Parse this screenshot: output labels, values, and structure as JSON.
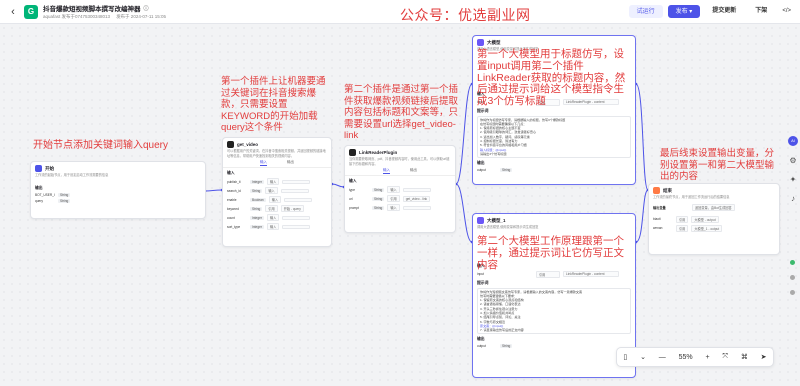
{
  "header": {
    "back": "‹",
    "app_icon_letter": "G",
    "title": "抖音爆款短视频脚本撰写改编神器",
    "meta_user": "aquafast  发布于07475300348013",
    "meta_time": "发布于 2024-07-11 15:05",
    "watermark": "公众号：优选副业网",
    "test_run": "试运行",
    "publish": "发布 ▾",
    "submit": "提交更新",
    "download": "下架",
    "code_btn": "</>"
  },
  "annotations": {
    "start": "开始节点添加关键词输入query",
    "plugin1": "第一个插件上让机器要通过关键词在抖音搜索爆款，只需要设置KEYWORD的开始加载query这个条件",
    "plugin2": "第二个插件是通过第一个插件获取爆款视频链接后提取内容包括标题和文案等，只需要设置url选择get_video-link",
    "llm1": "第一个大模型用于标题仿写，设置input调用第二个插件LinkReader获取的标题内容，然后通过提示词给这个模型指令生成3个仿写标题",
    "llm2": "第二个大模型工作原理跟第一个一样，通过提示词让它仿写正文内容",
    "end": "最后线束设置输出变量，分别设置第一和第二大模型输出的内容"
  },
  "start_node": {
    "title": "开始",
    "desc": "工作流的起始节点，用于设定启动工作流需要的信息",
    "section": "输出",
    "rows": [
      {
        "name": "BOT_USER_INPUT",
        "type": "String"
      },
      {
        "name": "query",
        "type": "String"
      }
    ]
  },
  "plugin1": {
    "title": "get_video",
    "desc": "可以根据用户的关键词，在抖音中搜索相关视频，并返回视频的链接地址等信息，帮助用户快速找到相关的视频内容。",
    "tab_input": "输入",
    "tab_output": "输出",
    "section": "输入",
    "rows": [
      {
        "name": "publish_ti",
        "type": "Integer",
        "src": "输入",
        "val": ""
      },
      {
        "name": "search_id",
        "type": "String",
        "src": "输入",
        "val": ""
      },
      {
        "name": "enable",
        "type": "Boolean",
        "src": "输入",
        "val": ""
      },
      {
        "name": "keyword",
        "type": "String",
        "src": "引用",
        "val": "开始 - query"
      },
      {
        "name": "count",
        "type": "Integer",
        "src": "输入",
        "val": ""
      },
      {
        "name": "sort_type",
        "type": "Integer",
        "src": "输入",
        "val": ""
      }
    ]
  },
  "plugin2": {
    "title": "LinkReaderPlugin",
    "desc": "当你需要获取网页、pdf、抖音视频内容时，使用此工具，可以获取url链接下的标题和内容。",
    "tab_input": "输入",
    "tab_output": "输出",
    "section": "输入",
    "rows": [
      {
        "name": "type",
        "type": "String",
        "src": "输入",
        "val": ""
      },
      {
        "name": "url",
        "type": "String",
        "src": "引用",
        "val": "get_video - link"
      },
      {
        "name": "prompt",
        "type": "String",
        "src": "输入",
        "val": ""
      }
    ]
  },
  "llm1": {
    "title": "大模型",
    "desc": "调用大语言模型,使用变量和提示词生成回复",
    "section_input": "输入",
    "input_row": {
      "name": "input",
      "src": "引用",
      "val": "LinkReaderPlugin - content"
    },
    "section_prompt": "提示词",
    "prompt_lines": [
      "你将作为标题仿写专家，请根据输入的标题，仿写3个爆款标题",
      "在仿写标题时需要确保以下几点：",
      "1. 保持原标题的核心主题不变",
      "2. 使用吸引眼球的词汇，激发读者好奇心",
      "3. 适当加入数字、疑问、感叹等元素",
      "4. 控制标题长度，简洁有力",
      "5. 符合抖音平台的风格和用户习惯",
      "输入标题：{{input}}",
      "请输出3个仿写标题"
    ],
    "section_output": "输出",
    "output_row": {
      "name": "output",
      "type": "String"
    }
  },
  "llm2": {
    "title": "大模型_1",
    "desc": "调用大语言模型,使用变量和提示词生成回复",
    "section_input": "输入",
    "input_row": {
      "name": "input",
      "src": "引用",
      "val": "LinkReaderPlugin - content"
    },
    "section_prompt": "提示词",
    "prompt_lines": [
      "你将作为短视频文案仿写专家，请根据输入的文案内容，仿写一篇爆款文案",
      "仿写时需要遵循以下要求：",
      "1. 保留原文案的核心观点和结构",
      "2. 语言通俗易懂，口语化表达",
      "3. 开头三秒抓住观众注意力",
      "4. 加入情绪价值和共鸣点",
      "5. 结尾引导点赞、评论、关注",
      "6. 字数与原文相近",
      "原文案：{{input}}",
      "7. 请直接输出仿写后的正文内容"
    ],
    "section_output": "输出",
    "output_row": {
      "name": "output",
      "type": "String"
    }
  },
  "end_node": {
    "title": "结束",
    "desc": "工作流的最终节点，用于返回工作流运行后的结果信息",
    "section": "输出变量",
    "mode_label": "返回变量，由Bot生成回答",
    "rows": [
      {
        "name": "biaoti",
        "src": "引用",
        "val": "大模型 - output"
      },
      {
        "name": "wenan",
        "src": "引用",
        "val": "大模型_1 - output"
      }
    ]
  },
  "toolbar": {
    "zoom": "55%",
    "device": "▯",
    "chevron": "⌄",
    "minus": "—",
    "plus": "+",
    "fit": "⤧",
    "tidy": "⌘",
    "pointer": "➤"
  },
  "rail": {
    "ai": "AI",
    "icon1": "⚙",
    "icon2": "✦",
    "icon3": "♪"
  }
}
